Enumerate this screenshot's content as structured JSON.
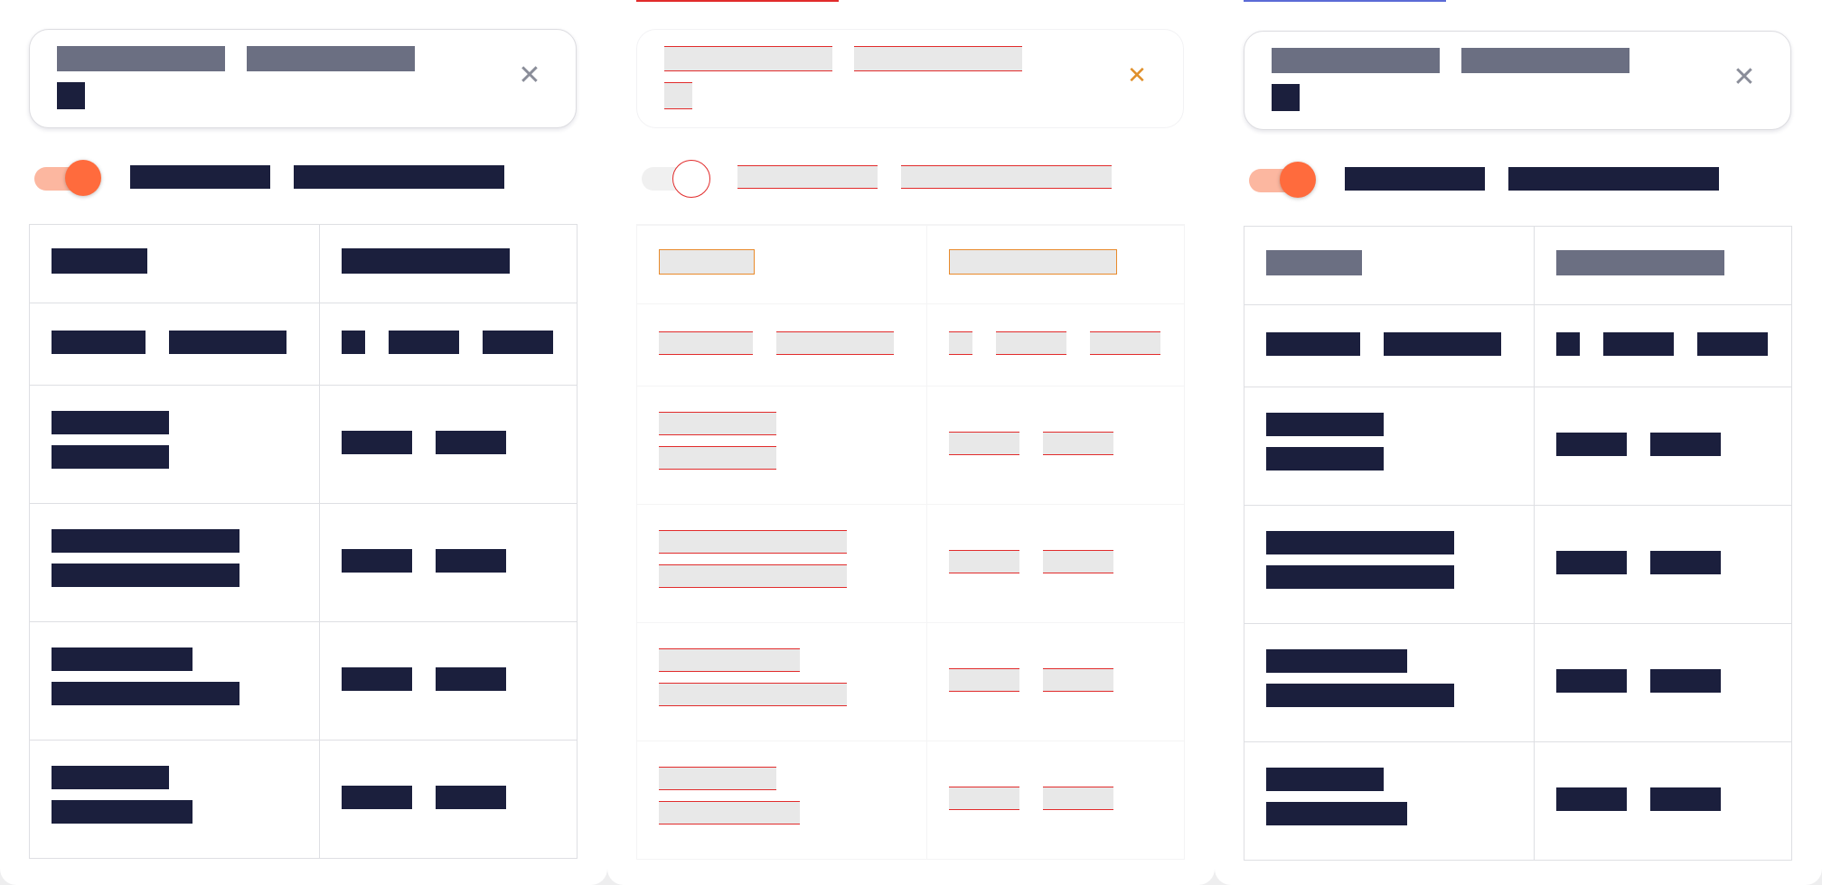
{
  "panels": [
    {
      "variant": "reference",
      "search": {
        "chip_1": "",
        "chip_2": "",
        "chip_3": ""
      },
      "toggle": {
        "on": true,
        "label_1": "",
        "label_2": ""
      },
      "table": {
        "headers": [
          "",
          ""
        ],
        "rows": [
          [
            [
              ""
            ],
            [
              ""
            ]
          ],
          [
            [
              "",
              ""
            ],
            [
              ""
            ]
          ],
          [
            [
              "",
              ""
            ],
            [
              ""
            ]
          ],
          [
            [
              "",
              ""
            ],
            [
              ""
            ]
          ],
          [
            [
              "",
              ""
            ],
            [
              ""
            ]
          ]
        ]
      }
    },
    {
      "variant": "diff",
      "search": {
        "chip_1": "",
        "chip_2": "",
        "chip_3": ""
      },
      "toggle": {
        "on": false,
        "label_1": "",
        "label_2": ""
      }
    },
    {
      "variant": "candidate",
      "search": {
        "chip_1": "",
        "chip_2": "",
        "chip_3": ""
      },
      "toggle": {
        "on": true,
        "label_1": "",
        "label_2": ""
      }
    }
  ],
  "close_icon": "close-icon",
  "colors": {
    "ink": "#1b1f3d",
    "muted_ink": "#6b6f82",
    "accent": "#ff6b3d",
    "accent_soft": "#fcb7a0",
    "diff_red": "#e12b2b",
    "diff_orange": "#e88a2b",
    "panel_c_accent": "#5b6bd6",
    "border": "#dedfe3"
  }
}
